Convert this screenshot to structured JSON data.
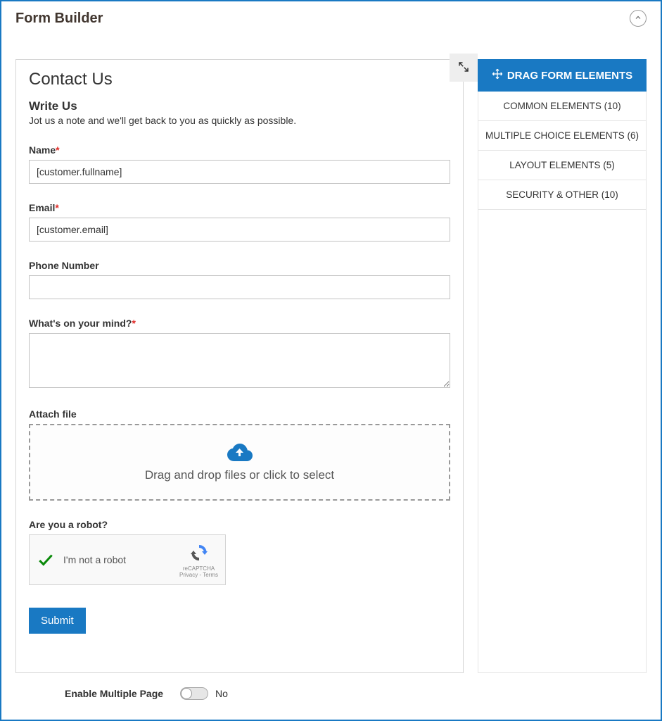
{
  "header": {
    "title": "Form Builder"
  },
  "canvas": {
    "title": "Contact Us",
    "section_heading": "Write Us",
    "section_sub": "Jot us a note and we'll get back to you as quickly as possible.",
    "fields": {
      "name": {
        "label": "Name",
        "required": true,
        "value": "[customer.fullname]"
      },
      "email": {
        "label": "Email",
        "required": true,
        "value": "[customer.email]"
      },
      "phone": {
        "label": "Phone Number",
        "required": false,
        "value": ""
      },
      "mind": {
        "label": "What's on your mind?",
        "required": true,
        "value": ""
      },
      "attach": {
        "label": "Attach file",
        "dropzone_text": "Drag and drop files or click to select"
      },
      "robot": {
        "label": "Are you a robot?",
        "checkbox_label": "I'm not a robot",
        "brand": "reCAPTCHA",
        "privacy": "Privacy - Terms"
      }
    },
    "submit": "Submit"
  },
  "sidebar": {
    "header": "DRAG FORM ELEMENTS",
    "categories": [
      "COMMON ELEMENTS (10)",
      "MULTIPLE CHOICE ELEMENTS (6)",
      "LAYOUT ELEMENTS (5)",
      "SECURITY & OTHER (10)"
    ]
  },
  "footer": {
    "label": "Enable Multiple Page",
    "value": "No"
  }
}
